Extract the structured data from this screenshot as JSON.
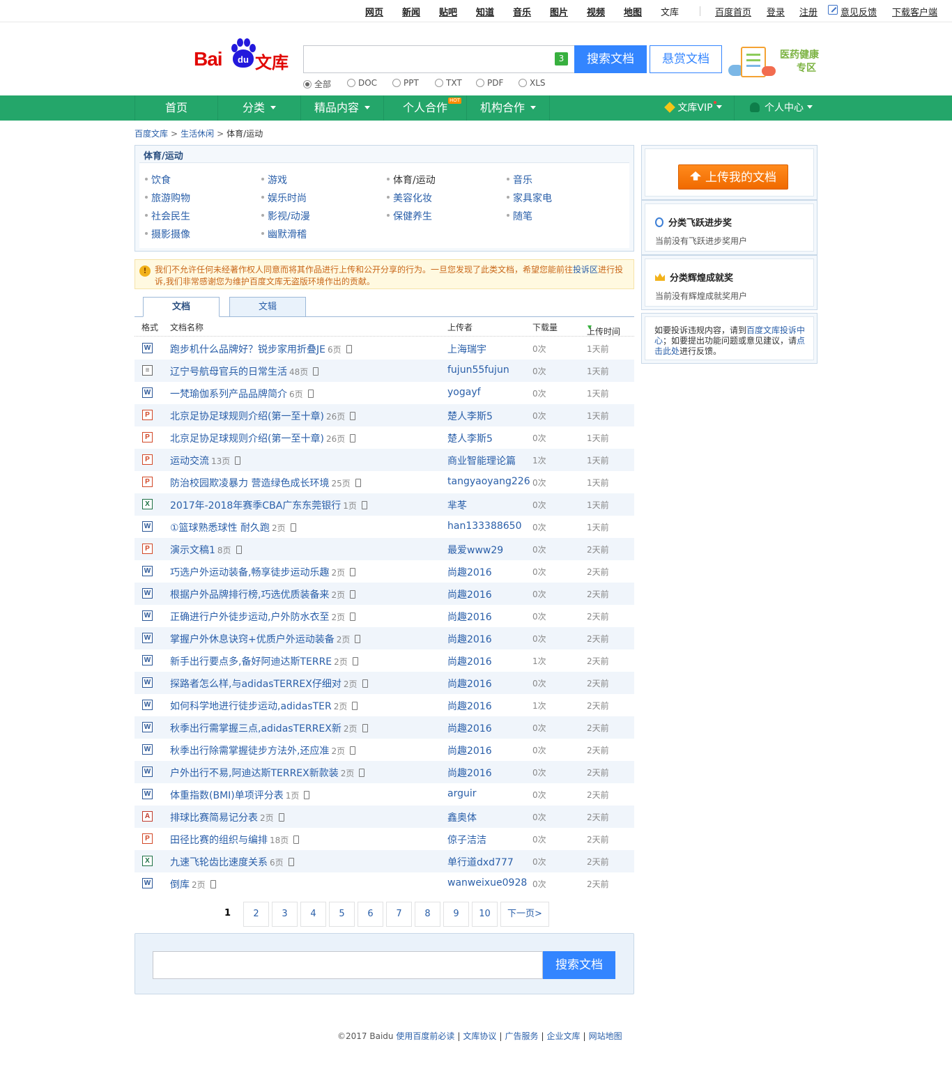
{
  "topnav": {
    "links": [
      "网页",
      "新闻",
      "贴吧",
      "知道",
      "音乐",
      "图片",
      "视频",
      "地图"
    ],
    "current": "文库",
    "right": [
      "百度首页",
      "登录",
      "注册",
      "意见反馈",
      "下载客户端"
    ]
  },
  "logo": {
    "bai": "Bai",
    "du": "du",
    "wenku": "文库"
  },
  "search": {
    "value": "",
    "count_badge": "3",
    "button": "搜索文档",
    "reward_button": "悬赏文档"
  },
  "filters": [
    {
      "label": "全部",
      "checked": true
    },
    {
      "label": "DOC",
      "checked": false
    },
    {
      "label": "PPT",
      "checked": false
    },
    {
      "label": "TXT",
      "checked": false
    },
    {
      "label": "PDF",
      "checked": false
    },
    {
      "label": "XLS",
      "checked": false
    }
  ],
  "promo": {
    "line1": "医药健康",
    "line2": "专区"
  },
  "nav": {
    "items": [
      "首页",
      "分类",
      "精品内容",
      "个人合作",
      "机构合作"
    ],
    "hot_badge": "HOT",
    "vip": "文库VIP",
    "personal": "个人中心"
  },
  "breadcrumb": {
    "home": "百度文库",
    "level1": "生活休闲",
    "current": "体育/运动",
    "sep": ">"
  },
  "category_panel": {
    "title": "体育/运动",
    "items": [
      "饮食",
      "游戏",
      "体育/运动",
      "音乐",
      "旅游购物",
      "娱乐时尚",
      "美容化妆",
      "家具家电",
      "社会民生",
      "影视/动漫",
      "保健养生",
      "随笔",
      "摄影摄像",
      "幽默滑稽"
    ],
    "current": "体育/运动"
  },
  "notice": {
    "icon": "!",
    "text_before": "我们不允许任何未经著作权人同意而将其作品进行上传和公开分享的行为。一旦您发现了此类文档，希望您能前往",
    "link": "投诉区",
    "text_after": "进行投诉,我们非常感谢您为维护百度文库无盗版环境作出的贡献。"
  },
  "tabs": [
    "文档",
    "文辑"
  ],
  "table_headers": {
    "format": "格式",
    "name": "文档名称",
    "uploader": "上传者",
    "downloads": "下载量",
    "time": "上传时间"
  },
  "documents": [
    {
      "type": "doc",
      "icon": "W",
      "title": "跑步机什么品牌好？锐步家用折叠JE",
      "pages": "6页",
      "uploader": "上海瑞宇",
      "downloads": "0次",
      "time": "1天前"
    },
    {
      "type": "txt",
      "icon": "≡",
      "title": "辽宁号航母官兵的日常生活",
      "pages": "48页",
      "uploader": "fujun55fujun",
      "downloads": "0次",
      "time": "1天前"
    },
    {
      "type": "doc",
      "icon": "W",
      "title": "一梵瑜伽系列产品品牌简介",
      "pages": "6页",
      "uploader": "yogayf",
      "downloads": "0次",
      "time": "1天前"
    },
    {
      "type": "ppt",
      "icon": "P",
      "title": "北京足协足球规则介绍(第一至十章)",
      "pages": "26页",
      "uploader": "楚人李斯5",
      "downloads": "0次",
      "time": "1天前"
    },
    {
      "type": "ppt",
      "icon": "P",
      "title": "北京足协足球规则介绍(第一至十章)",
      "pages": "26页",
      "uploader": "楚人李斯5",
      "downloads": "0次",
      "time": "1天前"
    },
    {
      "type": "ppt",
      "icon": "P",
      "title": "运动交流",
      "pages": "13页",
      "uploader": "商业智能理论篇",
      "downloads": "1次",
      "time": "1天前"
    },
    {
      "type": "ppt",
      "icon": "P",
      "title": "防治校园欺凌暴力 营造绿色成长环境",
      "pages": "25页",
      "uploader": "tangyaoyang226",
      "downloads": "0次",
      "time": "1天前"
    },
    {
      "type": "xls",
      "icon": "X",
      "title": "2017年-2018年赛季CBA广东东莞银行",
      "pages": "1页",
      "uploader": "芈苳",
      "downloads": "0次",
      "time": "1天前"
    },
    {
      "type": "doc",
      "icon": "W",
      "title": "①篮球熟悉球性 耐久跑",
      "pages": "2页",
      "uploader": "han133388650",
      "downloads": "0次",
      "time": "1天前"
    },
    {
      "type": "ppt",
      "icon": "P",
      "title": "演示文稿1",
      "pages": "8页",
      "uploader": "最爱www29",
      "downloads": "0次",
      "time": "2天前"
    },
    {
      "type": "doc",
      "icon": "W",
      "title": "巧选户外运动装备,畅享徒步运动乐趣",
      "pages": "2页",
      "uploader": "尚趣2016",
      "downloads": "0次",
      "time": "2天前"
    },
    {
      "type": "doc",
      "icon": "W",
      "title": "根据户外品牌排行榜,巧选优质装备来",
      "pages": "2页",
      "uploader": "尚趣2016",
      "downloads": "0次",
      "time": "2天前"
    },
    {
      "type": "doc",
      "icon": "W",
      "title": "正确进行户外徒步运动,户外防水衣至",
      "pages": "2页",
      "uploader": "尚趣2016",
      "downloads": "0次",
      "time": "2天前"
    },
    {
      "type": "doc",
      "icon": "W",
      "title": "掌握户外休息诀窍+优质户外运动装备",
      "pages": "2页",
      "uploader": "尚趣2016",
      "downloads": "0次",
      "time": "2天前"
    },
    {
      "type": "doc",
      "icon": "W",
      "title": "新手出行要点多,备好阿迪达斯TERRE",
      "pages": "2页",
      "uploader": "尚趣2016",
      "downloads": "1次",
      "time": "2天前"
    },
    {
      "type": "doc",
      "icon": "W",
      "title": "探路者怎么样,与adidasTERREX仔细对",
      "pages": "2页",
      "uploader": "尚趣2016",
      "downloads": "0次",
      "time": "2天前"
    },
    {
      "type": "doc",
      "icon": "W",
      "title": "如何科学地进行徒步运动,adidasTER",
      "pages": "2页",
      "uploader": "尚趣2016",
      "downloads": "1次",
      "time": "2天前"
    },
    {
      "type": "doc",
      "icon": "W",
      "title": "秋季出行需掌握三点,adidasTERREX新",
      "pages": "2页",
      "uploader": "尚趣2016",
      "downloads": "0次",
      "time": "2天前"
    },
    {
      "type": "doc",
      "icon": "W",
      "title": "秋季出行除需掌握徒步方法外,还应准",
      "pages": "2页",
      "uploader": "尚趣2016",
      "downloads": "0次",
      "time": "2天前"
    },
    {
      "type": "doc",
      "icon": "W",
      "title": "户外出行不易,阿迪达斯TERREX新款装",
      "pages": "2页",
      "uploader": "尚趣2016",
      "downloads": "0次",
      "time": "2天前"
    },
    {
      "type": "doc",
      "icon": "W",
      "title": "体重指数(BMI)单项评分表",
      "pages": "1页",
      "uploader": "arguir",
      "downloads": "0次",
      "time": "2天前"
    },
    {
      "type": "pdf",
      "icon": "A",
      "title": "排球比赛简易记分表",
      "pages": "2页",
      "uploader": "鑫奥体",
      "downloads": "0次",
      "time": "2天前"
    },
    {
      "type": "ppt",
      "icon": "P",
      "title": "田径比赛的组织与编排",
      "pages": "18页",
      "uploader": "倞子洁洁",
      "downloads": "0次",
      "time": "2天前"
    },
    {
      "type": "xls",
      "icon": "X",
      "title": "九速飞轮齿比速度关系",
      "pages": "6页",
      "uploader": "单行道dxd777",
      "downloads": "0次",
      "time": "2天前"
    },
    {
      "type": "doc",
      "icon": "W",
      "title": "倒库",
      "pages": "2页",
      "uploader": "wanweixue0928",
      "downloads": "0次",
      "time": "2天前"
    }
  ],
  "pagination": {
    "current": "1",
    "pages": [
      "2",
      "3",
      "4",
      "5",
      "6",
      "7",
      "8",
      "9",
      "10"
    ],
    "next": "下一页>"
  },
  "bottom_search": {
    "value": "",
    "button": "搜索文档"
  },
  "footer": {
    "copyright": "©2017 Baidu",
    "links": [
      "使用百度前必读",
      "文库协议",
      "广告服务",
      "企业文库",
      "网站地图"
    ],
    "sep": "|"
  },
  "sidebar": {
    "upload_button": "上传我的文档",
    "award1": {
      "title": "分类飞跃进步奖",
      "text": "当前没有飞跃进步奖用户"
    },
    "award2": {
      "title": "分类辉煌成就奖",
      "text": "当前没有辉煌成就奖用户"
    },
    "help": {
      "t1": "如要投诉违规内容，请到",
      "l1": "百度文库投诉中心",
      "t2": "；如要提出功能问题或意见建议，请",
      "l2": "点击此处",
      "t3": "进行反馈。"
    }
  },
  "colors": {
    "nav_green": "#24a66a",
    "search_blue": "#3385ff",
    "link_blue": "#2a5fa9",
    "upload_orange": "#ff7b00"
  }
}
